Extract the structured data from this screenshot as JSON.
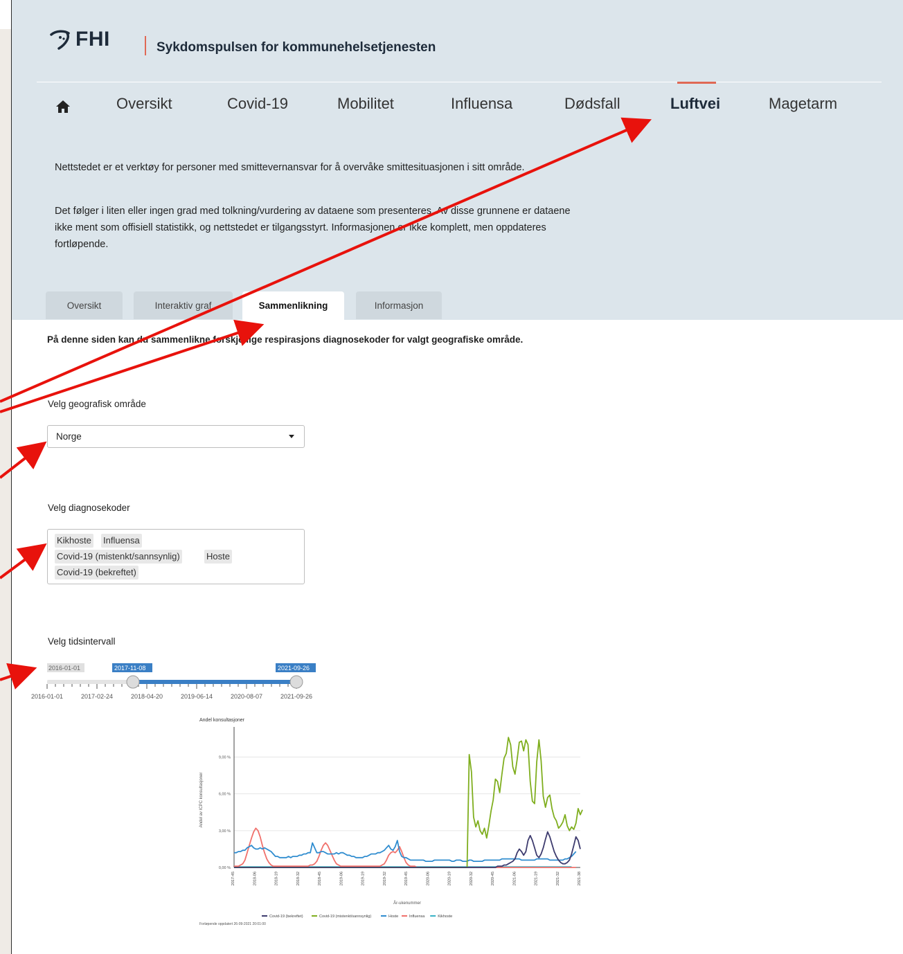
{
  "header": {
    "logo_text": "FHI",
    "site_title": "Sykdomspulsen for kommunehelsetjenesten"
  },
  "nav": {
    "home_icon": "home-icon",
    "items": [
      {
        "label": "Oversikt"
      },
      {
        "label": "Covid-19"
      },
      {
        "label": "Mobilitet"
      },
      {
        "label": "Influensa"
      },
      {
        "label": "Dødsfall"
      },
      {
        "label": "Luftvei",
        "active": true
      },
      {
        "label": "Magetarm"
      }
    ]
  },
  "intro": {
    "p1": "Nettstedet er et verktøy for personer med smittevernansvar for å overvåke smittesituasjonen i sitt område.",
    "p2": "Det følger i liten eller ingen grad med tolkning/vurdering av dataene som presenteres. Av disse grunnene er dataene ikke ment som offisiell statistikk, og nettstedet er tilgangsstyrt. Informasjonen er ikke komplett, men oppdateres fortløpende."
  },
  "tabs": [
    {
      "label": "Oversikt"
    },
    {
      "label": "Interaktiv graf"
    },
    {
      "label": "Sammenlikning",
      "active": true
    },
    {
      "label": "Informasjon"
    }
  ],
  "page_description": "På denne siden kan du sammenlikne forskjellige respirasjons diagnosekoder for valgt geografiske område.",
  "geo": {
    "label": "Velg geografisk område",
    "value": "Norge"
  },
  "diagnoses": {
    "label": "Velg diagnosekoder",
    "chips": [
      "Kikhoste",
      "Influensa",
      "Covid-19 (mistenkt/sannsynlig)",
      "Hoste",
      "Covid-19 (bekreftet)"
    ]
  },
  "time": {
    "label": "Velg tidsintervall",
    "min_label": "2016-01-01",
    "from": "2017-11-08",
    "to": "2021-09-26",
    "ticks": [
      "2016-01-01",
      "2017-02-24",
      "2018-04-20",
      "2019-06-14",
      "2020-08-07",
      "2021-09-26"
    ]
  },
  "chart_data": {
    "type": "line",
    "title": "Andel konsultasjoner",
    "xlabel": "År-ukenummer",
    "ylabel": "Andel av ICPC konsultasjoner",
    "ylim": [
      0,
      11
    ],
    "yticks": [
      "0,00 %",
      "3,00 %",
      "6,00 %",
      "9,00 %"
    ],
    "x_ticks": [
      "2017-45",
      "2018-06",
      "2018-19",
      "2018-32",
      "2018-45",
      "2019-06",
      "2019-19",
      "2019-32",
      "2019-45",
      "2020-06",
      "2020-19",
      "2020-32",
      "2020-45",
      "2021-06",
      "2021-19",
      "2021-32",
      "2021-38"
    ],
    "footnote": "Forløpende oppdatert 26-09-2021 20:01:00",
    "colors": {
      "covid_bekreftet": "#3d3b6e",
      "covid_mistenkt": "#7fae1e",
      "hoste": "#2f8ccf",
      "influensa": "#f0706b",
      "kikhoste": "#39b2c6"
    },
    "series": [
      {
        "name": "Covid-19 (bekreftet)",
        "color_key": "covid_bekreftet",
        "values": [
          0,
          0,
          0,
          0,
          0,
          0,
          0,
          0,
          0,
          0,
          0,
          0,
          0,
          0,
          0,
          0,
          0,
          0,
          0,
          0,
          0,
          0,
          0,
          0,
          0,
          0,
          0,
          0,
          0,
          0,
          0,
          0,
          0,
          0,
          0,
          0,
          0,
          0,
          0,
          0,
          0,
          0,
          0,
          0,
          0,
          0,
          0,
          0,
          0,
          0,
          0,
          0,
          0,
          0,
          0,
          0,
          0,
          0,
          0,
          0,
          0,
          0,
          0,
          0,
          0,
          0,
          0,
          0,
          0,
          0,
          0,
          0,
          0,
          0,
          0,
          0,
          0,
          0,
          0,
          0,
          0,
          0,
          0,
          0,
          0,
          0,
          0,
          0,
          0,
          0,
          0,
          0,
          0,
          0,
          0,
          0,
          0,
          0,
          0,
          0,
          0,
          0,
          0,
          0,
          0,
          0,
          0,
          0,
          0,
          0,
          0,
          0,
          0,
          0,
          0,
          0,
          0,
          0,
          0,
          0,
          0,
          0.1,
          0.1,
          0.1,
          0.2,
          0.2,
          0.3,
          0.4,
          0.5,
          0.7,
          1.2,
          1.5,
          1.3,
          1.0,
          1.3,
          2.2,
          2.6,
          2.2,
          1.6,
          1.0,
          0.8,
          1.1,
          1.6,
          2.3,
          2.9,
          2.5,
          1.9,
          1.3,
          0.9,
          0.6,
          0.4,
          0.3,
          0.3,
          0.4,
          0.6,
          1.1,
          1.8,
          2.5,
          2.2,
          1.5
        ]
      },
      {
        "name": "Covid-19 (mistenkt/sannsynlig)",
        "color_key": "covid_mistenkt",
        "values": [
          0,
          0,
          0,
          0,
          0,
          0,
          0,
          0,
          0,
          0,
          0,
          0,
          0,
          0,
          0,
          0,
          0,
          0,
          0,
          0,
          0,
          0,
          0,
          0,
          0,
          0,
          0,
          0,
          0,
          0,
          0,
          0,
          0,
          0,
          0,
          0,
          0,
          0,
          0,
          0,
          0,
          0,
          0,
          0,
          0,
          0,
          0,
          0,
          0,
          0,
          0,
          0,
          0,
          0,
          0,
          0,
          0,
          0,
          0,
          0,
          0,
          0,
          0,
          0,
          0,
          0,
          0,
          0,
          0,
          0,
          0,
          0,
          0,
          0,
          0,
          0,
          0,
          0,
          0,
          0,
          0,
          0,
          0,
          0,
          0,
          0,
          0,
          0,
          0,
          0,
          0,
          0,
          0,
          0,
          0,
          0,
          0,
          0,
          0,
          0,
          0,
          0,
          0,
          0,
          0,
          0,
          0,
          0,
          9.2,
          7.8,
          4.1,
          3.3,
          3.8,
          3.0,
          2.7,
          3.2,
          2.4,
          3.4,
          4.6,
          5.5,
          7.2,
          7.0,
          6.1,
          7.6,
          8.9,
          9.3,
          10.6,
          10.0,
          8.2,
          7.6,
          8.8,
          10.2,
          10.3,
          9.5,
          10.4,
          10.0,
          7.0,
          5.4,
          5.2,
          8.6,
          10.4,
          8.7,
          5.8,
          4.9,
          5.7,
          5.9,
          4.8,
          4.1,
          3.8,
          3.2,
          3.4,
          3.7,
          4.3,
          3.4,
          3.0,
          3.3,
          3.1,
          3.6,
          4.8,
          4.3,
          4.7
        ]
      },
      {
        "name": "Hoste",
        "color_key": "hoste",
        "values": [
          1.2,
          1.2,
          1.3,
          1.3,
          1.4,
          1.4,
          1.6,
          1.7,
          1.8,
          1.6,
          1.5,
          1.5,
          1.6,
          1.5,
          1.6,
          1.5,
          1.4,
          1.3,
          1.1,
          0.9,
          0.9,
          0.8,
          0.8,
          0.8,
          0.8,
          0.9,
          0.8,
          0.9,
          0.9,
          0.9,
          1.0,
          1.0,
          1.1,
          1.1,
          1.2,
          1.2,
          2.0,
          1.6,
          1.2,
          1.2,
          1.3,
          1.3,
          1.2,
          1.1,
          1.1,
          1.1,
          1.1,
          1.2,
          1.1,
          1.2,
          1.2,
          1.1,
          1.0,
          1.0,
          0.9,
          0.9,
          0.8,
          0.8,
          0.8,
          0.8,
          0.9,
          0.9,
          1.0,
          1.1,
          1.1,
          1.1,
          1.2,
          1.2,
          1.3,
          1.4,
          1.6,
          1.8,
          1.5,
          1.4,
          1.7,
          2.2,
          1.3,
          0.9,
          0.8,
          0.8,
          0.7,
          0.6,
          0.6,
          0.6,
          0.6,
          0.6,
          0.6,
          0.6,
          0.5,
          0.5,
          0.5,
          0.5,
          0.6,
          0.6,
          0.6,
          0.6,
          0.6,
          0.6,
          0.6,
          0.6,
          0.5,
          0.5,
          0.6,
          0.6,
          0.6,
          0.5,
          0.5,
          0.5,
          0.6,
          0.6,
          0.5,
          0.5,
          0.5,
          0.5,
          0.5,
          0.6,
          0.6,
          0.6,
          0.6,
          0.6,
          0.6,
          0.6,
          0.6,
          0.7,
          0.7,
          0.7,
          0.7,
          0.7,
          0.7,
          0.7,
          0.7,
          0.7,
          0.6,
          0.6,
          0.6,
          0.6,
          0.6,
          0.6,
          0.6,
          0.7,
          0.7,
          0.7,
          0.7,
          0.7,
          0.7,
          0.6,
          0.6,
          0.6,
          0.6,
          0.6,
          0.6,
          0.6,
          0.7,
          0.7,
          0.8,
          0.9,
          1.1,
          1.3
        ]
      },
      {
        "name": "Influensa",
        "color_key": "influensa",
        "values": [
          0.1,
          0.1,
          0.1,
          0.2,
          0.3,
          0.6,
          1.2,
          1.8,
          2.4,
          2.9,
          3.2,
          3.0,
          2.5,
          1.8,
          1.2,
          0.7,
          0.4,
          0.2,
          0.1,
          0.1,
          0.1,
          0.1,
          0.1,
          0.1,
          0.1,
          0.1,
          0.1,
          0.1,
          0.1,
          0.1,
          0.1,
          0.1,
          0.1,
          0.1,
          0.1,
          0.2,
          0.2,
          0.3,
          0.5,
          0.9,
          1.4,
          1.8,
          2.0,
          1.8,
          1.4,
          1.0,
          0.6,
          0.3,
          0.2,
          0.1,
          0.1,
          0.1,
          0.1,
          0.1,
          0.1,
          0.1,
          0.1,
          0.1,
          0.1,
          0.1,
          0.1,
          0.1,
          0.1,
          0.1,
          0.1,
          0.1,
          0.1,
          0.1,
          0.2,
          0.3,
          0.6,
          1.0,
          1.2,
          1.3,
          1.2,
          1.4,
          1.7,
          1.3,
          0.8,
          0.4,
          0.2,
          0.1,
          0.1,
          0.1,
          0.0,
          0.0,
          0.0,
          0.0,
          0.0,
          0.0,
          0.0,
          0.0,
          0.0,
          0.0,
          0.0,
          0.0,
          0.0,
          0.0,
          0.0,
          0.0,
          0.0,
          0.0,
          0.0,
          0.0,
          0.0,
          0.0,
          0.0,
          0.0,
          0.0,
          0.0,
          0.0,
          0.0,
          0.0,
          0.0,
          0.0,
          0.0,
          0.0,
          0.0,
          0.0,
          0.0,
          0.0,
          0.0,
          0.0,
          0.0,
          0.0,
          0.0,
          0.0,
          0.0,
          0.0,
          0.0,
          0.0,
          0.0,
          0.0,
          0.0,
          0.0,
          0.0,
          0.0,
          0.0,
          0.0,
          0.0,
          0.0,
          0.0,
          0.0,
          0.0,
          0.0,
          0.0,
          0.0,
          0.0,
          0.0,
          0.0,
          0.0,
          0.0,
          0.0,
          0.0,
          0.0,
          0.0,
          0.0,
          0.0
        ]
      },
      {
        "name": "Kikhoste",
        "color_key": "kikhoste",
        "values": [
          0.05,
          0.05,
          0.05,
          0.05,
          0.05,
          0.05,
          0.05,
          0.05,
          0.05,
          0.05,
          0.05,
          0.05,
          0.05,
          0.05,
          0.05,
          0.05,
          0.05,
          0.05,
          0.05,
          0.05,
          0.05,
          0.05,
          0.05,
          0.05,
          0.05,
          0.05,
          0.05,
          0.05,
          0.05,
          0.05,
          0.05,
          0.05,
          0.05,
          0.05,
          0.05,
          0.05,
          0.05,
          0.05,
          0.05,
          0.05,
          0.05,
          0.05,
          0.05,
          0.05,
          0.05,
          0.05,
          0.05,
          0.05,
          0.05,
          0.05,
          0.05,
          0.05,
          0.05,
          0.05,
          0.05,
          0.05,
          0.05,
          0.05,
          0.05,
          0.05,
          0.05,
          0.05,
          0.05,
          0.05,
          0.05,
          0.05,
          0.05,
          0.05,
          0.05,
          0.05,
          0.05,
          0.05,
          0.05,
          0.05,
          0.05,
          0.05,
          0.05,
          0.05,
          0.05,
          0.05,
          0.05,
          0.05,
          0.05,
          0.05,
          0.05,
          0.05,
          0.05,
          0.05,
          0.05,
          0.05,
          0.05,
          0.05,
          0.05,
          0.05,
          0.05,
          0.05,
          0.05,
          0.05,
          0.05,
          0.05,
          0.05,
          0.05,
          0.05,
          0.05,
          0.05,
          0.05,
          0.05,
          0.05,
          0.05,
          0.05,
          0.05,
          0.05,
          0.05,
          0.05,
          0.05,
          0.05,
          0.05,
          0.05,
          0.05,
          0.05,
          0.05,
          0.05,
          0.05,
          0.05,
          0.05,
          0.05,
          0.05,
          0.05,
          0.05,
          0.05,
          0.05,
          0.05,
          0.05,
          0.05,
          0.05,
          0.05,
          0.05,
          0.05,
          0.05,
          0.05,
          0.05,
          0.05,
          0.05,
          0.05,
          0.05,
          0.05,
          0.05,
          0.05,
          0.05,
          0.05,
          0.05,
          0.05,
          0.05,
          0.05,
          0.05,
          0.05
        ]
      }
    ],
    "legend": {
      "placement": "bottom"
    }
  },
  "annotation_color": "#e8120c"
}
